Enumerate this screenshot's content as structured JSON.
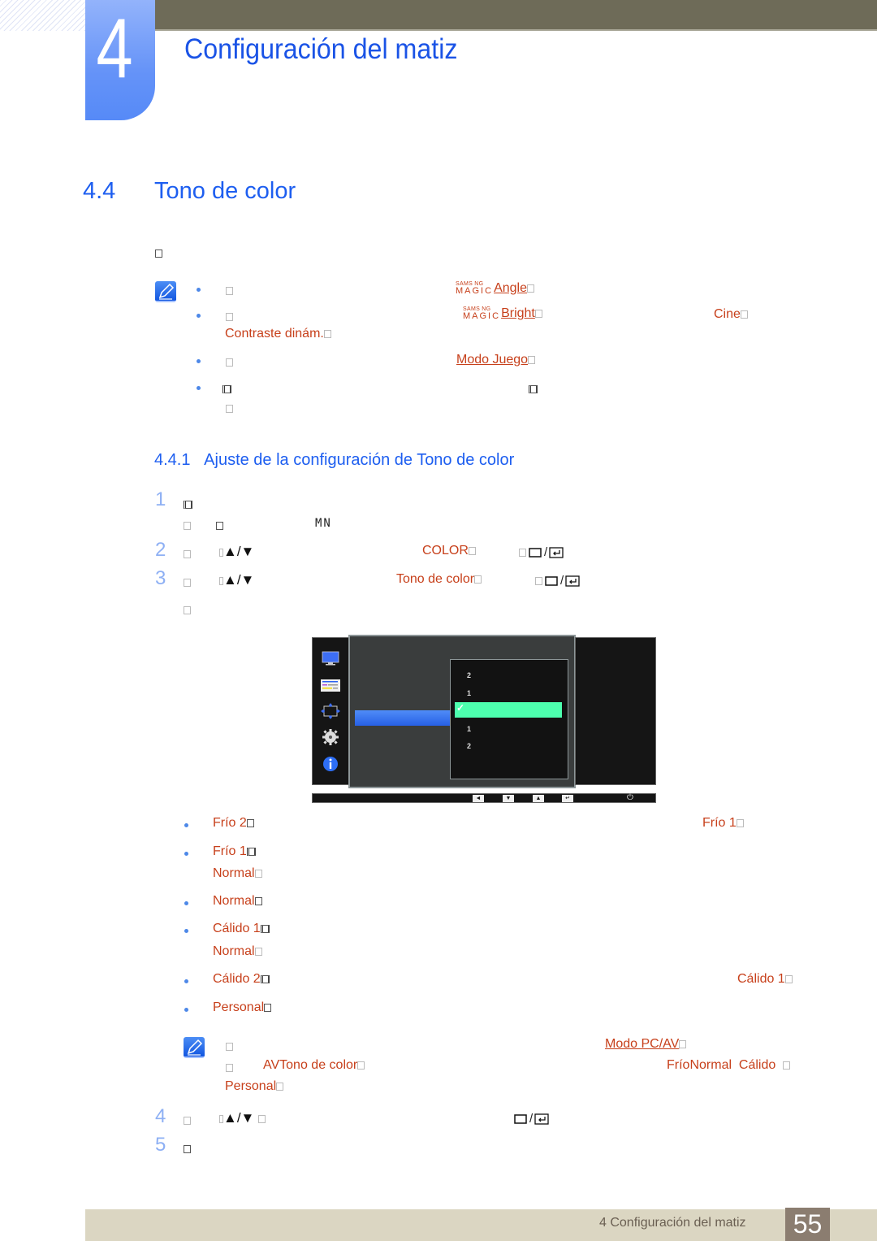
{
  "header": {
    "chapter_number": "4",
    "chapter_title": "Configuración del matiz"
  },
  "section": {
    "number": "4.4",
    "title": "Tono de color"
  },
  "notes_top": {
    "items": [
      {
        "brand_top": "SAMS NG",
        "brand_bottom": "MAGIC",
        "link": "Angle"
      },
      {
        "brand_top": "SAMS NG",
        "brand_bottom": "MAGIC",
        "link": "Bright",
        "extra": "Cine",
        "continuation": "Contraste dinám."
      },
      {
        "link": "Modo Juego"
      },
      {}
    ]
  },
  "subsection": {
    "number": "4.4.1",
    "title": "Ajuste de la configuración de Tono de color"
  },
  "steps": [
    {
      "num": "1",
      "line2_text": "MN"
    },
    {
      "num": "2",
      "arrows": "▲/▼",
      "target": "COLOR"
    },
    {
      "num": "3",
      "arrows": "▲/▼",
      "target": "Tono de color"
    },
    {
      "num": "4",
      "arrows": "▲/▼"
    },
    {
      "num": "5"
    }
  ],
  "osd": {
    "menu_icons": [
      "monitor-icon",
      "picture-settings-icon",
      "size-position-icon",
      "setup-gear-icon",
      "info-icon"
    ],
    "options": [
      "2",
      "1",
      "",
      "1",
      "2"
    ],
    "selected_index": 2,
    "selected_color": "#4dffae",
    "keys": [
      "◄",
      "▼",
      "▲",
      "↵",
      "⏻"
    ]
  },
  "options_list": [
    {
      "label": "Frío 2",
      "ref": "Frío 1"
    },
    {
      "label": "Frío 1",
      "continuation": "Normal"
    },
    {
      "label": "Normal"
    },
    {
      "label": "Cálido 1",
      "continuation": "Normal"
    },
    {
      "label": "Cálido 2",
      "ref": "Cálido 1"
    },
    {
      "label": "Personal"
    }
  ],
  "note_bottom": {
    "link": "Modo PC/AV",
    "line2_a": "AV",
    "line2_b": "Tono de color",
    "line2_c": "Frío",
    "line2_d": "Normal",
    "line2_e": "Cálido",
    "line3": "Personal"
  },
  "footer": {
    "text": "4 Configuración del matiz",
    "page": "55"
  },
  "colors": {
    "heading_blue": "#1d5ef0",
    "link_orange": "#c7401b",
    "step_num_blue": "#8eb0f4",
    "top_bar": "#6e6b58",
    "footer_bg": "#dbd6c2",
    "page_box": "#8b7d70"
  }
}
